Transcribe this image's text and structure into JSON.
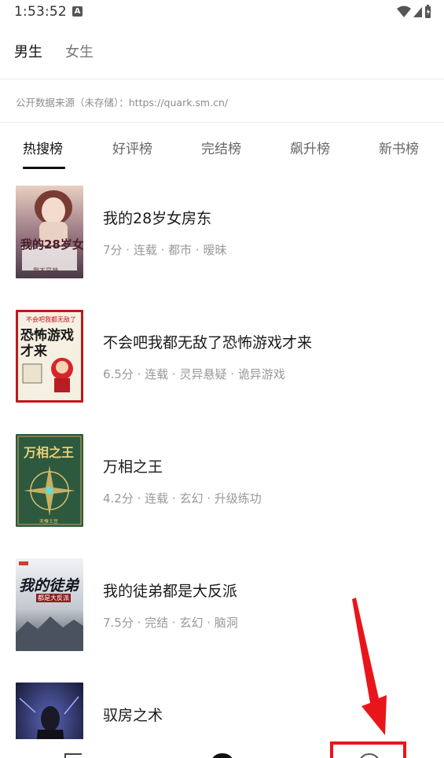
{
  "status_bar": {
    "time": "1:53:52",
    "notification_icon": "A"
  },
  "gender_tabs": [
    {
      "label": "男生",
      "active": true
    },
    {
      "label": "女生",
      "active": false
    }
  ],
  "source_note": "公开数据来源（未存储）：https://quark.sm.cn/",
  "rank_tabs": [
    {
      "label": "热搜榜",
      "active": true
    },
    {
      "label": "好评榜",
      "active": false
    },
    {
      "label": "完结榜",
      "active": false
    },
    {
      "label": "飙升榜",
      "active": false
    },
    {
      "label": "新书榜",
      "active": false
    }
  ],
  "books": [
    {
      "title": "我的28岁女房东",
      "meta": "7分 · 连载 · 都市 · 暧昧",
      "cover_text": "我的28岁女房东",
      "cover_subtext": "我不是神",
      "colors": {
        "bg": "#6c5566",
        "accent": "#d7b9a6"
      }
    },
    {
      "title": "不会吧我都无敌了恐怖游戏才来",
      "meta": "6.5分 · 连载 · 灵异悬疑 · 诡异游戏",
      "cover_text": "恐怖游戏才来",
      "cover_subtext": "不会吧我都无敌了",
      "colors": {
        "bg": "#f5efe0",
        "accent": "#c0171c"
      }
    },
    {
      "title": "万相之王",
      "meta": "4.2分 · 连载 · 玄幻 · 升级练功",
      "cover_text": "万相之王",
      "cover_subtext": "天蚕土豆",
      "colors": {
        "bg": "#2c5a3e",
        "accent": "#e0c06a"
      }
    },
    {
      "title": "我的徒弟都是大反派",
      "meta": "7.5分 · 完结 · 玄幻 · 脑洞",
      "cover_text": "我的徒弟",
      "cover_subtext": "都是大反派",
      "colors": {
        "bg": "#dfe2e6",
        "accent": "#1c2230"
      }
    },
    {
      "title": "驭房之术",
      "meta": "",
      "cover_text": "",
      "cover_subtext": "",
      "colors": {
        "bg": "#1d2040",
        "accent": "#7a8de0"
      }
    }
  ],
  "annotation": {
    "arrow_color": "#e8161b",
    "box_color": "#e8161b"
  }
}
